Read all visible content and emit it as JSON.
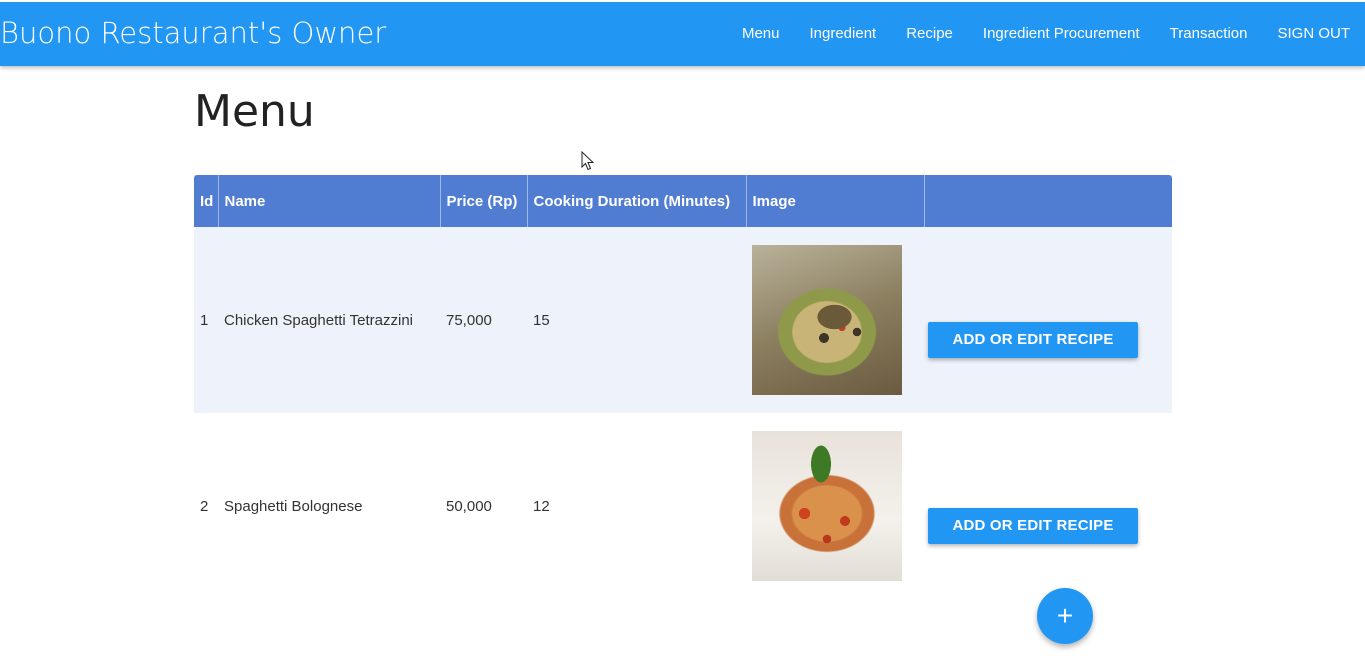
{
  "navbar": {
    "brand": "Buono Restaurant's Owner",
    "links": [
      {
        "label": "Menu"
      },
      {
        "label": "Ingredient"
      },
      {
        "label": "Recipe"
      },
      {
        "label": "Ingredient Procurement"
      },
      {
        "label": "Transaction"
      },
      {
        "label": "SIGN OUT"
      }
    ],
    "color": "#2196f3"
  },
  "page": {
    "title": "Menu"
  },
  "table": {
    "headers": [
      "Id",
      "Name",
      "Price (Rp)",
      "Cooking Duration (Minutes)",
      "Image",
      ""
    ],
    "header_color": "#507dd1",
    "rows": [
      {
        "id": "1",
        "name": "Chicken Spaghetti Tetrazzini",
        "price": "75,000",
        "duration": "15",
        "image": "chicken-spaghetti-tetrazzini-photo",
        "action": "ADD OR EDIT RECIPE"
      },
      {
        "id": "2",
        "name": "Spaghetti Bolognese",
        "price": "50,000",
        "duration": "12",
        "image": "spaghetti-bolognese-photo",
        "action": "ADD OR EDIT RECIPE"
      }
    ]
  },
  "fab": {
    "icon": "plus-icon",
    "symbol": "+"
  },
  "accent_color": "#2196f3"
}
